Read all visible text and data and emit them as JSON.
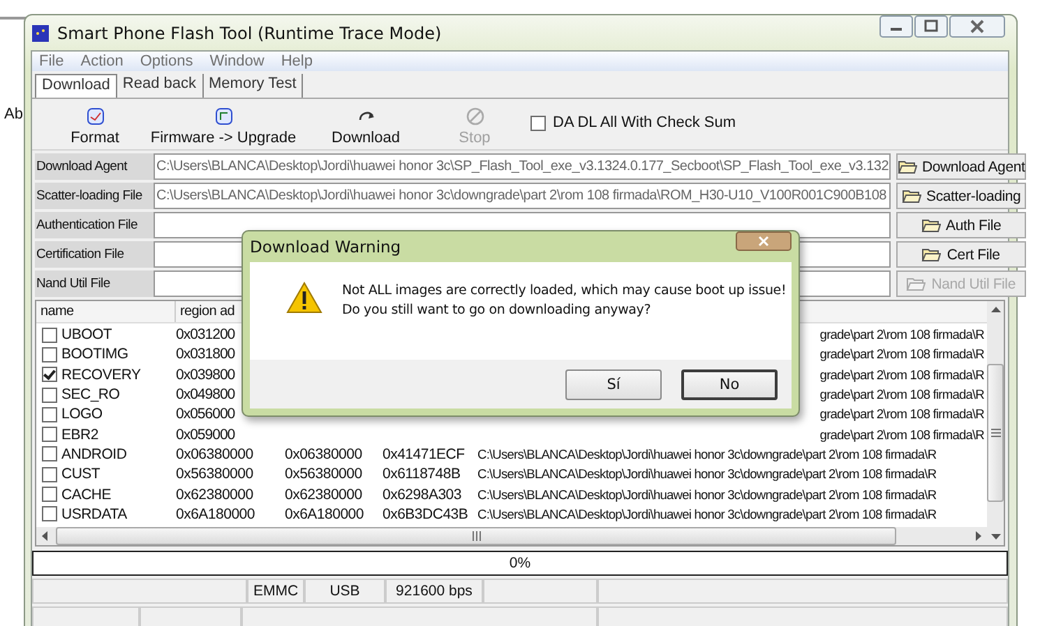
{
  "background_window": {
    "text": "Ab"
  },
  "window": {
    "title": "Smart Phone Flash Tool (Runtime Trace Mode)"
  },
  "menu": [
    "File",
    "Action",
    "Options",
    "Window",
    "Help"
  ],
  "tabs": [
    {
      "label": "Download",
      "selected": true
    },
    {
      "label": "Read back",
      "selected": false
    },
    {
      "label": "Memory Test",
      "selected": false
    }
  ],
  "toolbar": [
    {
      "kind": "format",
      "label": "Format",
      "disabled": false
    },
    {
      "kind": "firmware",
      "label": "Firmware -> Upgrade",
      "disabled": false
    },
    {
      "kind": "download",
      "label": "Download",
      "disabled": false
    },
    {
      "kind": "stop",
      "label": "Stop",
      "disabled": true
    }
  ],
  "checksum": {
    "label": "DA DL All With Check Sum",
    "checked": false
  },
  "file_fields": [
    {
      "label": "Download Agent",
      "value": "C:\\Users\\BLANCA\\Desktop\\Jordi\\huawei honor 3c\\SP_Flash_Tool_exe_v3.1324.0.177_Secboot\\SP_Flash_Tool_exe_v3.132"
    },
    {
      "label": "Scatter-loading File",
      "value": "C:\\Users\\BLANCA\\Desktop\\Jordi\\huawei honor 3c\\downgrade\\part 2\\rom 108 firmada\\ROM_H30-U10_V100R001C900B108"
    },
    {
      "label": "Authentication File"
    },
    {
      "label": "Certification File"
    },
    {
      "label": "Nand Util File"
    }
  ],
  "file_buttons": [
    {
      "label": "Download Agent",
      "disabled": false
    },
    {
      "label": "Scatter-loading",
      "disabled": false
    },
    {
      "label": "Auth File",
      "disabled": false
    },
    {
      "label": "Cert File",
      "disabled": false
    },
    {
      "label": "Nand Util File",
      "disabled": true
    }
  ],
  "table": {
    "columns": [
      "name",
      "region ad"
    ],
    "rows": [
      {
        "name": "UBOOT",
        "checked": false,
        "region_address": "0x031200",
        "location": "grade\\part 2\\rom 108 firmada\\R"
      },
      {
        "name": "BOOTIMG",
        "checked": false,
        "region_address": "0x031800",
        "location": "grade\\part 2\\rom 108 firmada\\R"
      },
      {
        "name": "RECOVERY",
        "checked": true,
        "region_address": "0x039800",
        "location": "grade\\part 2\\rom 108 firmada\\R"
      },
      {
        "name": "SEC_RO",
        "checked": false,
        "region_address": "0x049800",
        "location": "grade\\part 2\\rom 108 firmada\\R"
      },
      {
        "name": "LOGO",
        "checked": false,
        "region_address": "0x056000",
        "location": "grade\\part 2\\rom 108 firmada\\R"
      },
      {
        "name": "EBR2",
        "checked": false,
        "region_address": "0x059000",
        "location": "grade\\part 2\\rom 108 firmada\\R"
      },
      {
        "name": "ANDROID",
        "checked": false,
        "region_address": "0x06380000",
        "begin_address": "0x06380000",
        "end_address": "0x41471ECF",
        "location": "C:\\Users\\BLANCA\\Desktop\\Jordi\\huawei honor 3c\\downgrade\\part 2\\rom 108 firmada\\R"
      },
      {
        "name": "CUST",
        "checked": false,
        "region_address": "0x56380000",
        "begin_address": "0x56380000",
        "end_address": "0x6118748B",
        "location": "C:\\Users\\BLANCA\\Desktop\\Jordi\\huawei honor 3c\\downgrade\\part 2\\rom 108 firmada\\R"
      },
      {
        "name": "CACHE",
        "checked": false,
        "region_address": "0x62380000",
        "begin_address": "0x62380000",
        "end_address": "0x6298A303",
        "location": "C:\\Users\\BLANCA\\Desktop\\Jordi\\huawei honor 3c\\downgrade\\part 2\\rom 108 firmada\\R"
      },
      {
        "name": "USRDATA",
        "checked": false,
        "region_address": "0x6A180000",
        "begin_address": "0x6A180000",
        "end_address": "0x6B3DC43B",
        "location": "C:\\Users\\BLANCA\\Desktop\\Jordi\\huawei honor 3c\\downgrade\\part 2\\rom 108 firmada\\R"
      }
    ]
  },
  "progress": {
    "level": 0,
    "text": "0%"
  },
  "status_bar": [
    "EMMC",
    "USB",
    "921600 bps"
  ],
  "dialog": {
    "title": "Download Warning",
    "message": [
      "Not ALL images are correctly loaded, which may cause boot up issue!",
      "Do you still want to go on downloading anyway?"
    ],
    "buttons": [
      {
        "label": "Sí",
        "selected": false
      },
      {
        "label": "No",
        "selected": true
      }
    ]
  }
}
